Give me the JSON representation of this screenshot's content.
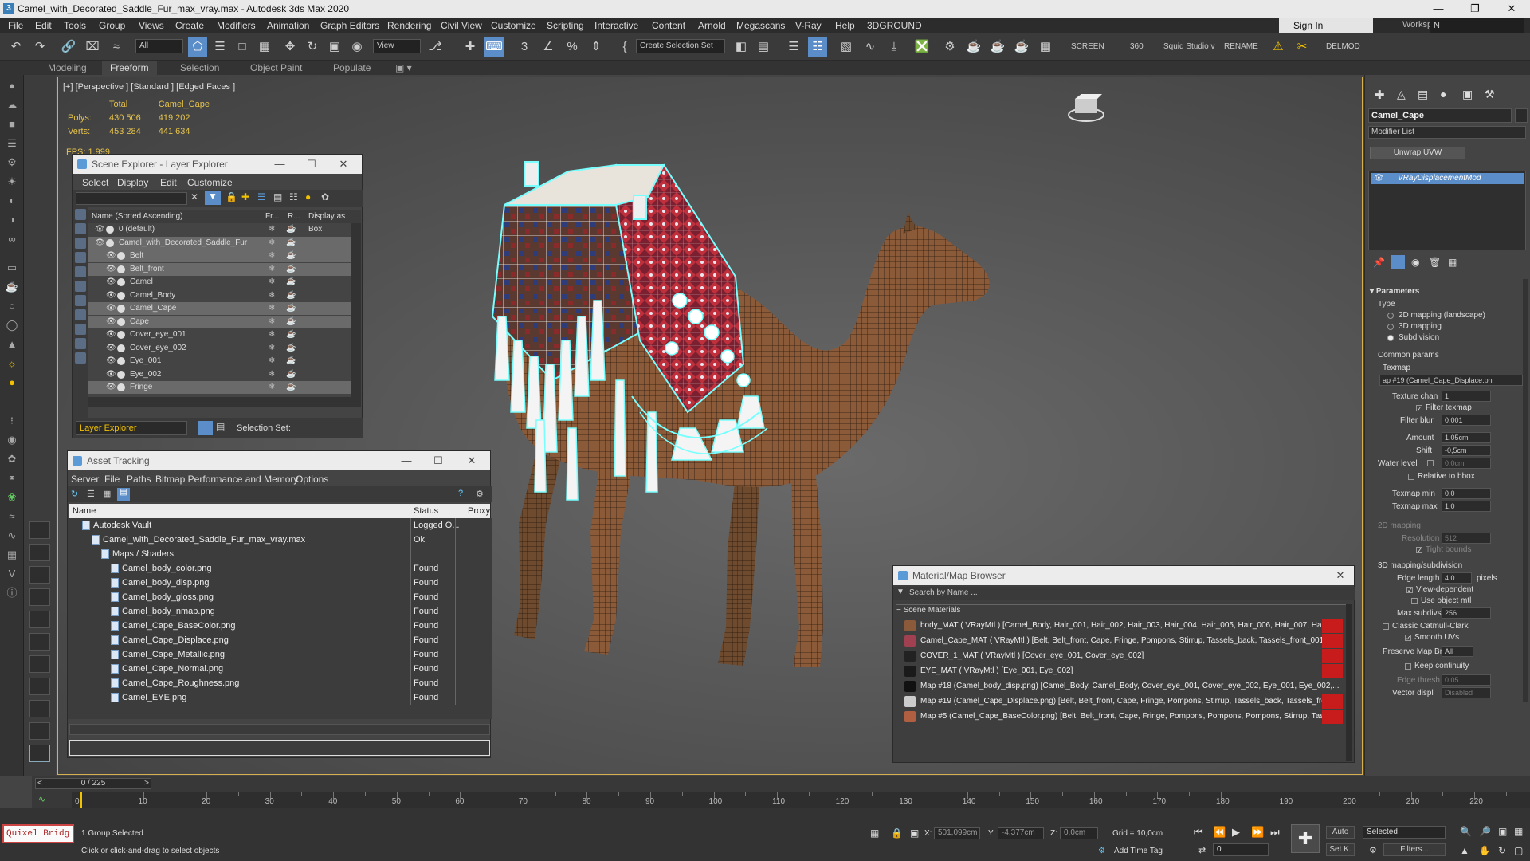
{
  "window": {
    "title": "Camel_with_Decorated_Saddle_Fur_max_vray.max - Autodesk 3ds Max 2020",
    "app_icon": "3"
  },
  "menus": [
    "File",
    "Edit",
    "Tools",
    "Group",
    "Views",
    "Create",
    "Modifiers",
    "Animation",
    "Graph Editors",
    "Rendering",
    "Civil View",
    "Customize",
    "Scripting",
    "Interactive",
    "Content",
    "Arnold",
    "Megascans",
    "V-Ray",
    "Help",
    "3DGROUND"
  ],
  "account": {
    "signin": "Sign In",
    "workspaces_label": "Workspaces:",
    "workspace_value": "N"
  },
  "toolbar": {
    "filter_value": "All",
    "view_value": "View",
    "selection_set": "Create Selection Set",
    "screen": "SCREEN",
    "n360": "360",
    "squid": "Squid Studio v",
    "rename": "RENAME",
    "delmod": "DELMOD"
  },
  "ribbon": {
    "tabs": [
      "Modeling",
      "Freeform",
      "Selection",
      "Object Paint",
      "Populate"
    ],
    "active": "Freeform"
  },
  "viewport": {
    "label": "[+] [Perspective ] [Standard ] [Edged Faces ]",
    "stats": {
      "col_total": "Total",
      "col_obj": "Camel_Cape",
      "polys_label": "Polys:",
      "polys_total": "430 506",
      "polys_obj": "419 202",
      "verts_label": "Verts:",
      "verts_total": "453 284",
      "verts_obj": "441 634"
    },
    "fps": "FPS:     1,999"
  },
  "scene_explorer": {
    "title": "Scene Explorer - Layer Explorer",
    "menu": [
      "Select",
      "Display",
      "Edit",
      "Customize"
    ],
    "columns": {
      "name": "Name (Sorted Ascending)",
      "fr": "Fr...",
      "r": "R...",
      "box": "Display as Box"
    },
    "rows": [
      {
        "name": "0 (default)",
        "indent": 0,
        "selected": false
      },
      {
        "name": "Camel_with_Decorated_Saddle_Fur",
        "indent": 0,
        "selected": true
      },
      {
        "name": "Belt",
        "indent": 1,
        "selected": true
      },
      {
        "name": "Belt_front",
        "indent": 1,
        "selected": true
      },
      {
        "name": "Camel",
        "indent": 1,
        "selected": false
      },
      {
        "name": "Camel_Body",
        "indent": 1,
        "selected": false
      },
      {
        "name": "Camel_Cape",
        "indent": 1,
        "selected": true
      },
      {
        "name": "Cape",
        "indent": 1,
        "selected": true
      },
      {
        "name": "Cover_eye_001",
        "indent": 1,
        "selected": false
      },
      {
        "name": "Cover_eye_002",
        "indent": 1,
        "selected": false
      },
      {
        "name": "Eye_001",
        "indent": 1,
        "selected": false
      },
      {
        "name": "Eye_002",
        "indent": 1,
        "selected": false
      },
      {
        "name": "Fringe",
        "indent": 1,
        "selected": true
      }
    ],
    "footer_explorer": "Layer Explorer",
    "footer_selset": "Selection Set:"
  },
  "asset_tracking": {
    "title": "Asset Tracking",
    "menu": [
      "Server",
      "File",
      "Paths",
      "Bitmap Performance and Memory",
      "Options"
    ],
    "columns": {
      "name": "Name",
      "status": "Status",
      "proxy": "Proxy"
    },
    "rows": [
      {
        "name": "Autodesk Vault",
        "status": "Logged O...",
        "indent": 1
      },
      {
        "name": "Camel_with_Decorated_Saddle_Fur_max_vray.max",
        "status": "Ok",
        "indent": 2
      },
      {
        "name": "Maps / Shaders",
        "status": "",
        "indent": 3
      },
      {
        "name": "Camel_body_color.png",
        "status": "Found",
        "indent": 4
      },
      {
        "name": "Camel_body_disp.png",
        "status": "Found",
        "indent": 4
      },
      {
        "name": "Camel_body_gloss.png",
        "status": "Found",
        "indent": 4
      },
      {
        "name": "Camel_body_nmap.png",
        "status": "Found",
        "indent": 4
      },
      {
        "name": "Camel_Cape_BaseColor.png",
        "status": "Found",
        "indent": 4
      },
      {
        "name": "Camel_Cape_Displace.png",
        "status": "Found",
        "indent": 4
      },
      {
        "name": "Camel_Cape_Metallic.png",
        "status": "Found",
        "indent": 4
      },
      {
        "name": "Camel_Cape_Normal.png",
        "status": "Found",
        "indent": 4
      },
      {
        "name": "Camel_Cape_Roughness.png",
        "status": "Found",
        "indent": 4
      },
      {
        "name": "Camel_EYE.png",
        "status": "Found",
        "indent": 4
      }
    ]
  },
  "material_browser": {
    "title": "Material/Map Browser",
    "search_placeholder": "Search by Name ...",
    "section": "Scene Materials",
    "rows": [
      {
        "text": "body_MAT  ( VRayMtl )  [Camel_Body, Hair_001, Hair_002, Hair_003, Hair_004, Hair_005, Hair_006, Hair_007, Hair_...",
        "swatch": "#8a5a3a",
        "red": true
      },
      {
        "text": "Camel_Cape_MAT  ( VRayMtl )  [Belt, Belt_front, Cape, Fringe, Pompons, Stirrup, Tassels_back, Tassels_front_001, T...",
        "swatch": "#a04050",
        "red": true
      },
      {
        "text": "COVER_1_MAT  ( VRayMtl )  [Cover_eye_001, Cover_eye_002]",
        "swatch": "#222222",
        "red": true
      },
      {
        "text": "EYE_MAT  ( VRayMtl )  [Eye_001, Eye_002]",
        "swatch": "#1a1a1a",
        "red": true
      },
      {
        "text": "Map #18 (Camel_body_disp.png)  [Camel_Body, Camel_Body, Cover_eye_001, Cover_eye_002, Eye_001, Eye_002,...",
        "swatch": "#111111",
        "red": false
      },
      {
        "text": "Map #19 (Camel_Cape_Displace.png)  [Belt, Belt_front, Cape, Fringe, Pompons, Stirrup, Tassels_back, Tassels_front...",
        "swatch": "#cccccc",
        "red": true
      },
      {
        "text": "Map #5 (Camel_Cape_BaseColor.png)  [Belt, Belt_front, Cape, Fringe, Pompons, Pompons, Pompons, Stirrup, Tassels...",
        "swatch": "#b06040",
        "red": true
      }
    ]
  },
  "command_panel": {
    "object_name": "Camel_Cape",
    "modifier_list": "Modifier List",
    "unwrap_btn": "Unwrap UVW",
    "stack_item": "VRayDisplacementMod",
    "rollout": "Parameters",
    "type_label": "Type",
    "types": [
      "2D mapping (landscape)",
      "3D mapping",
      "Subdivision"
    ],
    "common_params": "Common params",
    "texmap_label": "Texmap",
    "texmap_value": "ap #19 (Camel_Cape_Displace.pn",
    "texture_chan_label": "Texture chan",
    "texture_chan": "1",
    "filter_texmap": "Filter texmap",
    "filter_blur_label": "Filter blur",
    "filter_blur": "0,001",
    "amount_label": "Amount",
    "amount": "1,05cm",
    "shift_label": "Shift",
    "shift": "-0,5cm",
    "water_label": "Water level",
    "water": "0,0cm",
    "relative_bbox": "Relative to bbox",
    "texmap_min_label": "Texmap min",
    "texmap_min": "0,0",
    "texmap_max_label": "Texmap max",
    "texmap_max": "1,0",
    "mapping2d": "2D mapping",
    "resolution_label": "Resolution",
    "resolution": "512",
    "tight_bounds": "Tight bounds",
    "mapping3d": "3D mapping/subdivision",
    "edge_length_label": "Edge length",
    "edge_length": "4,0",
    "pixels": "pixels",
    "view_dependent": "View-dependent",
    "use_object_mtl": "Use object mtl",
    "max_subdivs_label": "Max subdivs",
    "max_subdivs": "256",
    "classic_cc": "Classic Catmull-Clark",
    "smooth_uvs": "Smooth UVs",
    "preserve_label": "Preserve Map Bnd",
    "preserve": "All",
    "keep_continuity": "Keep continuity",
    "edge_thresh_label": "Edge thresh",
    "edge_thresh": "0,05",
    "vector_displ_label": "Vector displ",
    "vector_displ": "Disabled"
  },
  "timeline": {
    "frame_counter": "0 / 225",
    "ticks": [
      0,
      10,
      20,
      30,
      40,
      50,
      60,
      70,
      80,
      90,
      100,
      110,
      120,
      130,
      140,
      150,
      160,
      170,
      180,
      190,
      200,
      210,
      220
    ]
  },
  "status": {
    "quixel": "Quixel Bridg",
    "selected": "1 Group Selected",
    "hint": "Click or click-and-drag to select objects",
    "x_label": "X:",
    "x": "501,099cm",
    "y_label": "Y:",
    "y": "-4,377cm",
    "z_label": "Z:",
    "z": "0,0cm",
    "grid": "Grid = 10,0cm",
    "add_time_tag": "Add Time Tag",
    "auto": "Auto",
    "set_key": "Set K.",
    "selected_dd": "Selected",
    "filters": "Filters...",
    "frame": "0"
  }
}
